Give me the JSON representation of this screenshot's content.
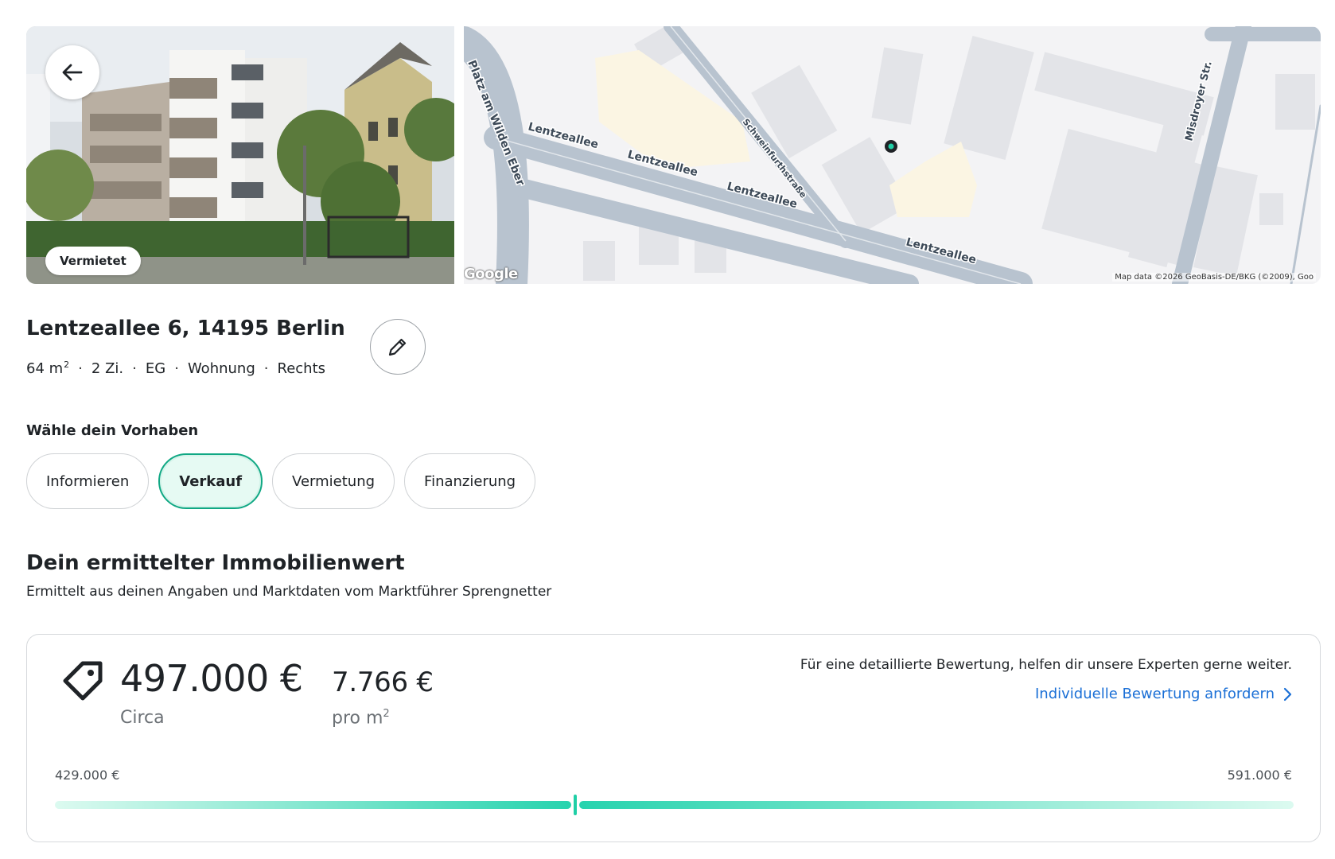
{
  "property": {
    "address": "Lentzeallee 6, 14195 Berlin",
    "size_value": "64 m",
    "size_unit_sup": "2",
    "rooms": "2 Zi.",
    "floor": "EG",
    "type": "Wohnung",
    "position": "Rechts",
    "status_badge": "Vermietet"
  },
  "map": {
    "attribution": "Map data ©2026 GeoBasis-DE/BKG (©2009), Goo",
    "logo": "Google",
    "streets": [
      "Platz am Wilden Eber",
      "Lentzeallee",
      "Lentzeallee",
      "Lentzeallee",
      "Lentzeallee",
      "Schweinfurthstraße",
      "Misdroyer Str."
    ],
    "pin_color": "#1fcfa6"
  },
  "intent": {
    "label": "Wähle dein Vorhaben",
    "options": [
      "Informieren",
      "Verkauf",
      "Vermietung",
      "Finanzierung"
    ],
    "selected": "Verkauf"
  },
  "valuation": {
    "heading": "Dein ermittelter Immobilienwert",
    "subheading": "Ermittelt aus deinen Angaben und Marktdaten vom Marktführer Sprengnetter",
    "price": "497.000 €",
    "price_caption": "Circa",
    "price_per_sqm": "7.766 €",
    "price_per_sqm_caption": "pro m",
    "price_per_sqm_caption_sup": "2",
    "expert_text": "Für eine detaillierte Bewertung, helfen dir unsere Experten gerne weiter.",
    "expert_link": "Individuelle Bewertung anfordern",
    "range_min": "429.000 €",
    "range_max": "591.000 €",
    "range_min_value": 429000,
    "range_max_value": 591000,
    "estimate_value": 497000
  },
  "colors": {
    "accent": "#1fcfa6",
    "link": "#1a6fd6",
    "chip_active_bg": "#e6faf3",
    "chip_active_border": "#11a884"
  },
  "icons": [
    "arrow-left-icon",
    "pencil-icon",
    "price-tag-icon",
    "chevron-right-icon",
    "map-pin-icon"
  ]
}
